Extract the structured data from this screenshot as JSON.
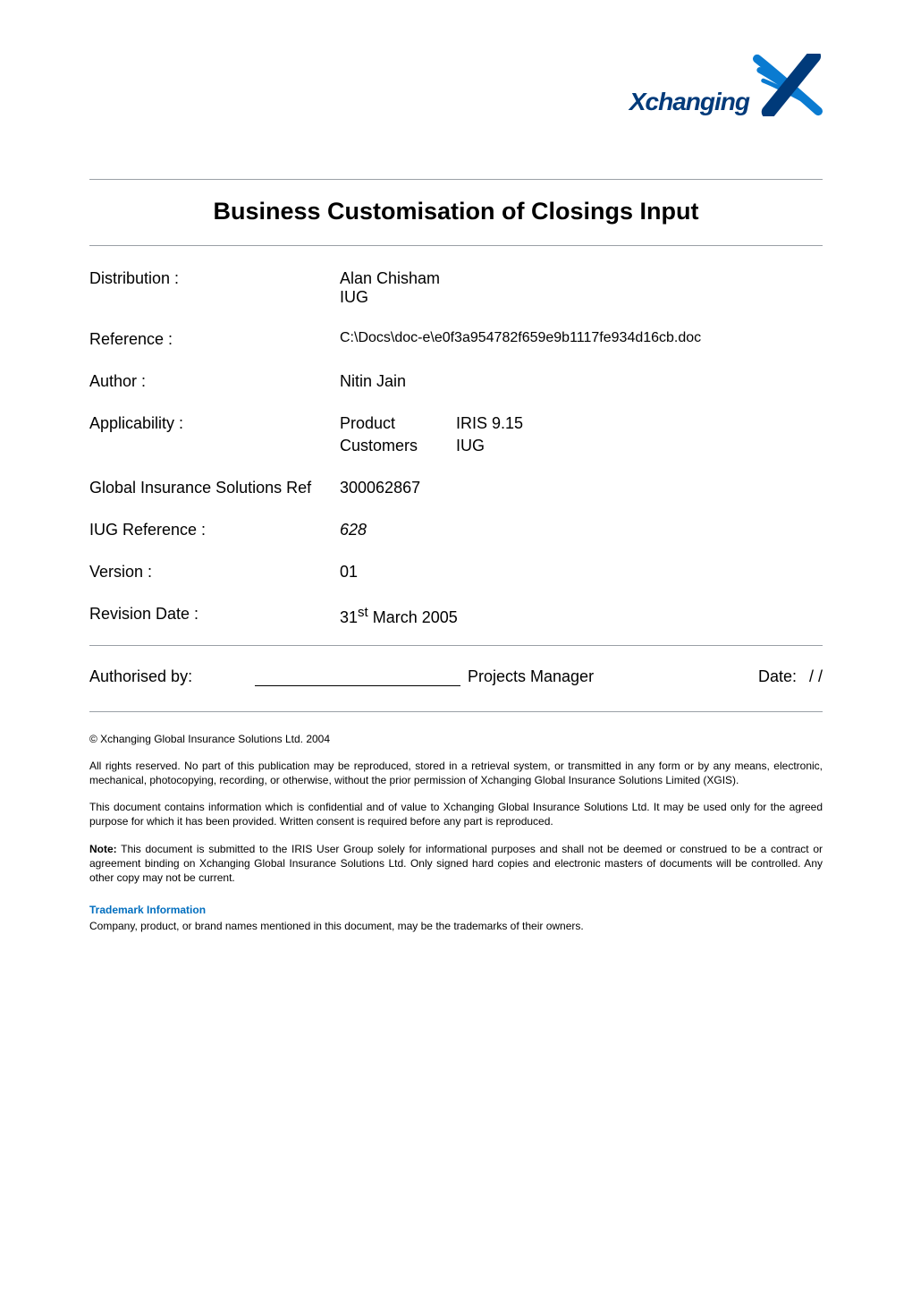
{
  "logo": {
    "name_text": "Xchanging"
  },
  "title": "Business Customisation of Closings Input",
  "meta": {
    "distribution": {
      "label": "Distribution :",
      "value_lines": [
        "Alan Chisham",
        "IUG"
      ]
    },
    "reference": {
      "label": "Reference :",
      "value": "C:\\Docs\\doc-e\\e0f3a954782f659e9b1117fe934d16cb.doc"
    },
    "author": {
      "label": "Author :",
      "value": "Nitin Jain"
    },
    "applicability": {
      "label": "Applicability :",
      "rows": [
        {
          "k": "Product",
          "v": "IRIS 9.15"
        },
        {
          "k": "Customers",
          "v": "IUG"
        }
      ]
    },
    "gis_ref": {
      "label": "Global Insurance Solutions Ref",
      "value": "300062867"
    },
    "iug_ref": {
      "label": "IUG Reference :",
      "value": "628",
      "italic": true
    },
    "version": {
      "label": "Version :",
      "value": "01"
    },
    "revision": {
      "label": "Revision Date :",
      "value_pre": "31",
      "value_sup": "st",
      "value_post": " March 2005"
    }
  },
  "auth": {
    "label": "Authorised by:",
    "role": "Projects Manager",
    "date_label": "Date:",
    "date_value": "/   /"
  },
  "legal": {
    "copyright": "© Xchanging Global Insurance Solutions Ltd. 2004",
    "p1": "All rights reserved.  No part of this publication may be reproduced, stored in a retrieval system, or transmitted in any form or by any means, electronic, mechanical, photocopying, recording, or otherwise, without the prior permission of Xchanging Global Insurance Solutions Limited (XGIS).",
    "p2": "This document contains information which is confidential and of value to Xchanging Global Insurance Solutions Ltd.  It may be used only for the agreed purpose for which it has been provided.  Written consent is required before any part is reproduced.",
    "note_strong": "Note:",
    "p3_after_note": " This document is submitted to the IRIS User Group solely for informational purposes and shall not be deemed or construed to be a contract or agreement binding on Xchanging Global Insurance Solutions Ltd.  Only signed hard copies and electronic masters of documents will be controlled.  Any other copy may not be current.",
    "tm_head": "Trademark Information",
    "tm_body": "Company, product, or brand names mentioned in this document, may be the trademarks of their owners."
  }
}
